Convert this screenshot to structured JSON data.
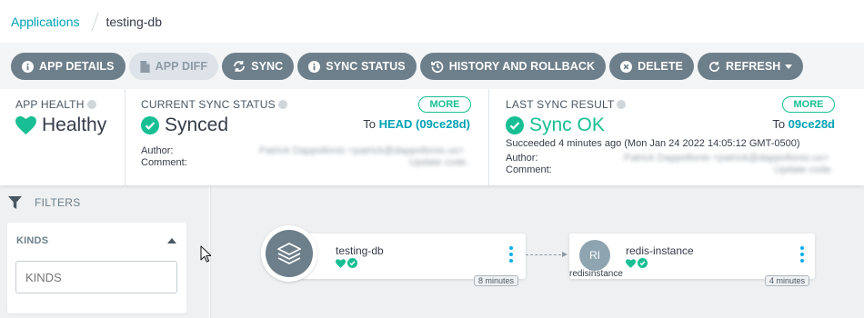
{
  "breadcrumb": {
    "root": "Applications",
    "current": "testing-db"
  },
  "toolbar": {
    "app_details": "APP DETAILS",
    "app_diff": "APP DIFF",
    "sync": "SYNC",
    "sync_status": "SYNC STATUS",
    "history": "HISTORY AND ROLLBACK",
    "delete": "DELETE",
    "refresh": "REFRESH"
  },
  "app_health": {
    "title": "APP HEALTH",
    "status": "Healthy"
  },
  "current_sync": {
    "title": "CURRENT SYNC STATUS",
    "status": "Synced",
    "more": "MORE",
    "to_prefix": "To",
    "revision": "HEAD (09ce28d)",
    "author_label": "Author:",
    "comment_label": "Comment:",
    "author_value": "Patrick Dappollonio <patrick@dappollonio.us>",
    "comment_value": "Update code."
  },
  "last_sync": {
    "title": "LAST SYNC RESULT",
    "status": "Sync OK",
    "more": "MORE",
    "to_prefix": "To",
    "revision": "09ce28d",
    "succeeded": "Succeeded 4 minutes ago (Mon Jan 24 2022 14:05:12 GMT-0500)",
    "author_label": "Author:",
    "comment_label": "Comment:",
    "author_value": "Patrick Dappollonio <patrick@dappollonio.us>",
    "comment_value": "Update code."
  },
  "filters": {
    "title": "FILTERS",
    "kinds_title": "KINDS",
    "kinds_placeholder": "KINDS"
  },
  "graph": {
    "app_node": {
      "name": "testing-db",
      "age": "8 minutes"
    },
    "resource_node": {
      "name": "redis-instance",
      "abbrev": "RI",
      "kind": "redisinstance",
      "age": "4 minutes"
    }
  },
  "colors": {
    "accent": "#00a2b3",
    "healthy": "#18be94",
    "button": "#6d7f8b",
    "menu_dots": "#0dadea"
  },
  "icons": [
    "info-icon",
    "file-icon",
    "sync-icon",
    "history-icon",
    "close-circle-icon",
    "refresh-icon",
    "help-icon",
    "heart-icon",
    "check-circle-icon",
    "filter-icon",
    "layers-icon",
    "kebab-menu-icon"
  ]
}
